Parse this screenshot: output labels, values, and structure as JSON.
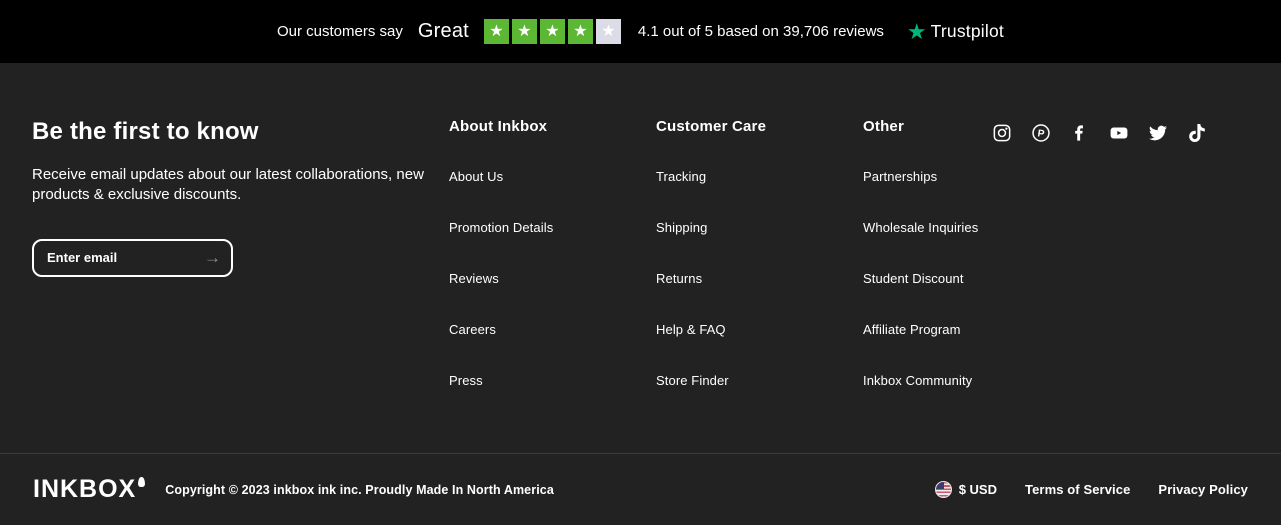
{
  "trustbar": {
    "prefix": "Our customers say",
    "rating_word": "Great",
    "stars_filled": 4,
    "stars_total": 5,
    "star_glyph": "★",
    "summary": "4.1 out of 5 based on 39,706 reviews",
    "brand": "Trustpilot",
    "colors": {
      "filled_star_bg": "#5CB734",
      "empty_star_bg": "#DCDCE6",
      "brand_star": "#00B67A",
      "bar_bg": "#000000"
    }
  },
  "newsletter": {
    "title": "Be the first to know",
    "description": "Receive email updates about our latest collaborations, new products & exclusive discounts.",
    "email_placeholder": "Enter email",
    "email_value": "",
    "submit_icon": "→"
  },
  "columns": [
    {
      "header": "About Inkbox",
      "links": [
        "About Us",
        "Promotion Details",
        "Reviews",
        "Careers",
        "Press"
      ]
    },
    {
      "header": "Customer Care",
      "links": [
        "Tracking",
        "Shipping",
        "Returns",
        "Help & FAQ",
        "Store Finder"
      ]
    },
    {
      "header": "Other",
      "links": [
        "Partnerships",
        "Wholesale Inquiries",
        "Student Discount",
        "Affiliate Program",
        "Inkbox Community"
      ]
    }
  ],
  "social": {
    "icons": [
      "instagram",
      "pinterest",
      "facebook",
      "youtube",
      "twitter",
      "tiktok"
    ]
  },
  "bottom": {
    "logo": "INKBOX",
    "copyright": "Copyright © 2023 inkbox ink inc. Proudly Made In North America",
    "currency": "$ USD",
    "links": [
      "Terms of Service",
      "Privacy Policy"
    ],
    "colors": {
      "background": "#222222",
      "divider": "#3a3a3a"
    }
  }
}
